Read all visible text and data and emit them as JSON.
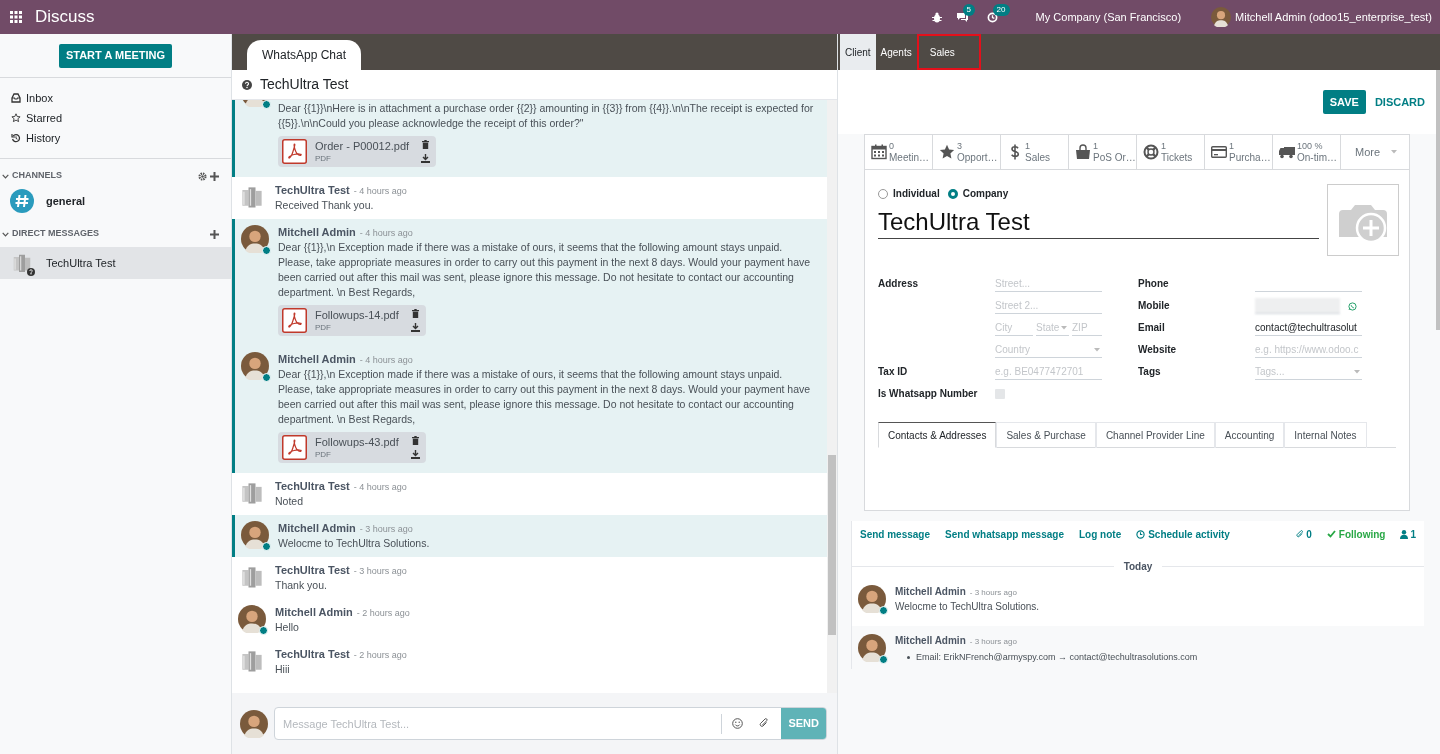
{
  "topbar": {
    "app_title": "Discuss",
    "chat_badge": "5",
    "activity_badge": "20",
    "company": "My Company (San Francisco)",
    "user": "Mitchell Admin (odoo15_enterprise_test)"
  },
  "sidebar": {
    "start_button": "START A MEETING",
    "mailboxes": [
      {
        "kind": "inbox",
        "label": "Inbox"
      },
      {
        "kind": "star",
        "label": "Starred"
      },
      {
        "kind": "history",
        "label": "History"
      }
    ],
    "channels_header": "CHANNELS",
    "channels": [
      {
        "name": "general",
        "selected": false
      }
    ],
    "dm_header": "DIRECT MESSAGES",
    "direct_messages": [
      {
        "name": "TechUltra Test",
        "selected": true
      }
    ]
  },
  "chat": {
    "tab": "WhatsApp Chat",
    "title": "TechUltra Test",
    "messages": [
      {
        "kind": "admin",
        "highlighted": true,
        "body": "Dear {{1}}\\nHere is in attachment a purchase order {{2}} amounting in {{3}} from {{4}}.\\n\\nThe receipt is expected for {{5}}.\\n\\nCould you please acknowledge the receipt of this order?\"",
        "attachments": [
          {
            "name": "Order - P00012.pdf",
            "type": "PDF"
          }
        ]
      },
      {
        "kind": "partner",
        "highlighted": false,
        "author": "TechUltra Test",
        "time": "- 4 hours ago",
        "body": "Received Thank you."
      },
      {
        "kind": "admin",
        "highlighted": true,
        "author": "Mitchell Admin",
        "time": "- 4 hours ago",
        "body": "Dear {{1}},\\n Exception made if there was a mistake of ours, it seems that the following amount stays unpaid. Please, take appropriate measures in order to carry out this payment in the next 8 days. Would your payment have been carried out after this mail was sent, please ignore this message. Do not hesitate to contact our accounting department. \\n Best Regards,",
        "attachments": [
          {
            "name": "Followups-14.pdf",
            "type": "PDF"
          }
        ]
      },
      {
        "kind": "admin",
        "highlighted": true,
        "author": "Mitchell Admin",
        "time": "- 4 hours ago",
        "body": "Dear {{1}},\\n Exception made if there was a mistake of ours, it seems that the following amount stays unpaid. Please, take appropriate measures in order to carry out this payment in the next 8 days. Would your payment have been carried out after this mail was sent, please ignore this message. Do not hesitate to contact our accounting department. \\n Best Regards,",
        "attachments": [
          {
            "name": "Followups-43.pdf",
            "type": "PDF"
          }
        ]
      },
      {
        "kind": "partner",
        "highlighted": false,
        "author": "TechUltra Test",
        "time": "- 4 hours ago",
        "body": "Noted"
      },
      {
        "kind": "admin",
        "highlighted": true,
        "author": "Mitchell Admin",
        "time": "- 3 hours ago",
        "body": "Welocme to TechUltra Solutions."
      },
      {
        "kind": "partner",
        "highlighted": false,
        "author": "TechUltra Test",
        "time": "- 3 hours ago",
        "body": "Thank you."
      },
      {
        "kind": "admin",
        "highlighted": false,
        "author": "Mitchell Admin",
        "time": "- 2 hours ago",
        "body": "Hello"
      },
      {
        "kind": "partner",
        "highlighted": false,
        "author": "TechUltra Test",
        "time": "- 2 hours ago",
        "body": "Hiii"
      }
    ],
    "composer": {
      "placeholder": "Message TechUltra Test...",
      "send": "SEND"
    }
  },
  "record_tabs": [
    {
      "label": "Client",
      "selected": true,
      "highlighted": false
    },
    {
      "label": "Agents",
      "selected": false,
      "highlighted": false
    },
    {
      "label": "Sales",
      "selected": false,
      "highlighted": true
    }
  ],
  "buttons": {
    "save": "SAVE",
    "discard": "DISCARD"
  },
  "smart_buttons": [
    {
      "kind": "calendar",
      "value": "0",
      "label": "Meetin…"
    },
    {
      "kind": "star",
      "value": "3",
      "label": "Opport…"
    },
    {
      "kind": "dollar",
      "value": "1",
      "label": "Sales"
    },
    {
      "kind": "bag",
      "value": "1",
      "label": "PoS Or…"
    },
    {
      "kind": "lifebuoy",
      "value": "1",
      "label": "Tickets"
    },
    {
      "kind": "card",
      "value": "1",
      "label": "Purcha…"
    },
    {
      "kind": "truck",
      "value": "100 %",
      "label": "On-tim…"
    },
    {
      "kind": "more",
      "label": "More"
    }
  ],
  "form": {
    "company_type": [
      {
        "label": "Individual",
        "selected": false
      },
      {
        "label": "Company",
        "selected": true
      }
    ],
    "name": "TechUltra Test",
    "address_label": "Address",
    "street_placeholder": "Street...",
    "street2_placeholder": "Street 2...",
    "city_placeholder": "City",
    "state_placeholder": "State",
    "zip_placeholder": "ZIP",
    "country_placeholder": "Country",
    "tax_id_label": "Tax ID",
    "tax_id_placeholder": "e.g. BE0477472701",
    "whatsapp_label": "Is Whatsapp Number",
    "whatsapp_checked": false,
    "phone_label": "Phone",
    "mobile_label": "Mobile",
    "email_label": "Email",
    "email": "contact@techultrasolut",
    "website_label": "Website",
    "website_placeholder": "e.g. https://www.odoo.c",
    "tags_label": "Tags",
    "tags_placeholder": "Tags..."
  },
  "notebook": [
    {
      "label": "Contacts & Addresses",
      "selected": true
    },
    {
      "label": "Sales & Purchase",
      "selected": false
    },
    {
      "label": "Channel Provider Line",
      "selected": false
    },
    {
      "label": "Accounting",
      "selected": false
    },
    {
      "label": "Internal Notes",
      "selected": false
    }
  ],
  "chatter": {
    "actions": [
      {
        "kind": "plain",
        "label": "Send message"
      },
      {
        "kind": "plain",
        "label": "Send whatsapp message"
      },
      {
        "kind": "plain",
        "label": "Log note"
      },
      {
        "kind": "clock",
        "label": "Schedule activity"
      }
    ],
    "attachments_count": "0",
    "following": "Following",
    "followers_count": "1",
    "divider": "Today",
    "messages": [
      {
        "kind": "plain",
        "author": "Mitchell Admin",
        "time": "- 3 hours ago",
        "body": "Welocme to TechUltra Solutions."
      },
      {
        "kind": "tracking",
        "author": "Mitchell Admin",
        "time": "- 3 hours ago",
        "body": "Email: ErikNFrench@armyspy.com → contact@techultrasolutions.com"
      }
    ]
  }
}
